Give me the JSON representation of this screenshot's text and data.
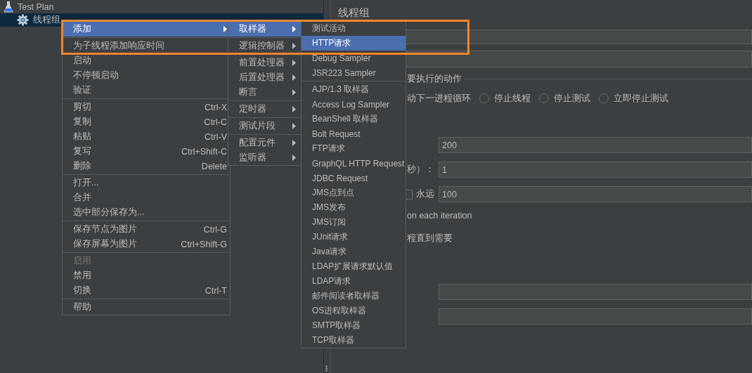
{
  "tree": [
    {
      "label": "Test Plan",
      "selected": false,
      "children": [
        {
          "label": "线程组",
          "selected": true
        }
      ]
    }
  ],
  "panel": {
    "title": "线程组",
    "group_label": "要执行的动作",
    "partial_label": "动下一进程循环",
    "radios": [
      {
        "label": "停止线程",
        "selected": false
      },
      {
        "label": "停止测试",
        "selected": false
      },
      {
        "label": "立即停止测试",
        "selected": false
      }
    ],
    "rows": [
      {
        "kind": "field",
        "value": "200"
      },
      {
        "kind": "field",
        "label": "秒）：",
        "value": "1"
      },
      {
        "kind": "checkbox-field",
        "label": "永远",
        "checked": false,
        "value": "100"
      },
      {
        "kind": "text",
        "label": "on each iteration"
      },
      {
        "kind": "text",
        "label": "程直到需要"
      },
      {
        "kind": "gap"
      },
      {
        "kind": "field"
      },
      {
        "kind": "field"
      }
    ]
  },
  "menus": [
    {
      "items": [
        {
          "kind": "item",
          "label": "添加",
          "submenu": true,
          "selected": true,
          "disabled": false
        },
        {
          "kind": "separator"
        },
        {
          "kind": "item",
          "label": "为子线程添加响应时间",
          "submenu": false,
          "selected": false,
          "disabled": false
        },
        {
          "kind": "item",
          "label": "启动",
          "submenu": false,
          "selected": false,
          "disabled": false
        },
        {
          "kind": "item",
          "label": "不停顿启动",
          "submenu": false,
          "selected": false,
          "disabled": false
        },
        {
          "kind": "item",
          "label": "验证",
          "submenu": false,
          "selected": false,
          "disabled": false
        },
        {
          "kind": "separator"
        },
        {
          "kind": "item",
          "label": "剪切",
          "shortcut": "Ctrl-X",
          "submenu": false,
          "selected": false,
          "disabled": false
        },
        {
          "kind": "item",
          "label": "复制",
          "shortcut": "Ctrl-C",
          "submenu": false,
          "selected": false,
          "disabled": false
        },
        {
          "kind": "item",
          "label": "粘贴",
          "shortcut": "Ctrl-V",
          "submenu": false,
          "selected": false,
          "disabled": false
        },
        {
          "kind": "item",
          "label": "复写",
          "shortcut": "Ctrl+Shift-C",
          "submenu": false,
          "selected": false,
          "disabled": false
        },
        {
          "kind": "item",
          "label": "删除",
          "shortcut": "Delete",
          "submenu": false,
          "selected": false,
          "disabled": false
        },
        {
          "kind": "separator"
        },
        {
          "kind": "item",
          "label": "打开...",
          "submenu": false,
          "selected": false,
          "disabled": false
        },
        {
          "kind": "item",
          "label": "合并",
          "submenu": false,
          "selected": false,
          "disabled": false
        },
        {
          "kind": "item",
          "label": "选中部分保存为...",
          "submenu": false,
          "selected": false,
          "disabled": false
        },
        {
          "kind": "separator"
        },
        {
          "kind": "item",
          "label": "保存节点为图片",
          "shortcut": "Ctrl-G",
          "submenu": false,
          "selected": false,
          "disabled": false
        },
        {
          "kind": "item",
          "label": "保存屏幕为图片",
          "shortcut": "Ctrl+Shift-G",
          "submenu": false,
          "selected": false,
          "disabled": false
        },
        {
          "kind": "separator"
        },
        {
          "kind": "item",
          "label": "启用",
          "submenu": false,
          "selected": false,
          "disabled": true
        },
        {
          "kind": "item",
          "label": "禁用",
          "submenu": false,
          "selected": false,
          "disabled": false
        },
        {
          "kind": "item",
          "label": "切换",
          "shortcut": "Ctrl-T",
          "submenu": false,
          "selected": false,
          "disabled": false
        },
        {
          "kind": "separator"
        },
        {
          "kind": "item",
          "label": "帮助",
          "submenu": false,
          "selected": false,
          "disabled": false
        }
      ]
    },
    {
      "items": [
        {
          "kind": "item",
          "label": "取样器",
          "submenu": true,
          "selected": true,
          "disabled": false
        },
        {
          "kind": "separator"
        },
        {
          "kind": "item",
          "label": "逻辑控制器",
          "submenu": true,
          "selected": false,
          "disabled": false
        },
        {
          "kind": "separator"
        },
        {
          "kind": "item",
          "label": "前置处理器",
          "submenu": true,
          "selected": false,
          "disabled": false
        },
        {
          "kind": "item",
          "label": "后置处理器",
          "submenu": true,
          "selected": false,
          "disabled": false
        },
        {
          "kind": "item",
          "label": "断言",
          "submenu": true,
          "selected": false,
          "disabled": false
        },
        {
          "kind": "separator"
        },
        {
          "kind": "item",
          "label": "定时器",
          "submenu": true,
          "selected": false,
          "disabled": false
        },
        {
          "kind": "separator"
        },
        {
          "kind": "item",
          "label": "测试片段",
          "submenu": true,
          "selected": false,
          "disabled": false
        },
        {
          "kind": "separator"
        },
        {
          "kind": "item",
          "label": "配置元件",
          "submenu": true,
          "selected": false,
          "disabled": false
        },
        {
          "kind": "item",
          "label": "监听器",
          "submenu": true,
          "selected": false,
          "disabled": false
        }
      ]
    },
    {
      "items": [
        {
          "kind": "item",
          "label": "测试活动",
          "selected": false,
          "disabled": false
        },
        {
          "kind": "item",
          "label": "HTTP请求",
          "selected": true,
          "disabled": false
        },
        {
          "kind": "item",
          "label": "Debug Sampler",
          "selected": false,
          "disabled": false
        },
        {
          "kind": "item",
          "label": "JSR223 Sampler",
          "selected": false,
          "disabled": false
        },
        {
          "kind": "separator"
        },
        {
          "kind": "item",
          "label": "AJP/1.3 取样器",
          "selected": false,
          "disabled": false
        },
        {
          "kind": "item",
          "label": "Access Log Sampler",
          "selected": false,
          "disabled": false
        },
        {
          "kind": "item",
          "label": "BeanShell 取样器",
          "selected": false,
          "disabled": false
        },
        {
          "kind": "item",
          "label": "Bolt Request",
          "selected": false,
          "disabled": false
        },
        {
          "kind": "item",
          "label": "FTP请求",
          "selected": false,
          "disabled": false
        },
        {
          "kind": "item",
          "label": "GraphQL HTTP Request",
          "selected": false,
          "disabled": false
        },
        {
          "kind": "item",
          "label": "JDBC Request",
          "selected": false,
          "disabled": false
        },
        {
          "kind": "item",
          "label": "JMS点到点",
          "selected": false,
          "disabled": false
        },
        {
          "kind": "item",
          "label": "JMS发布",
          "selected": false,
          "disabled": false
        },
        {
          "kind": "item",
          "label": "JMS订阅",
          "selected": false,
          "disabled": false
        },
        {
          "kind": "item",
          "label": "JUnit请求",
          "selected": false,
          "disabled": false
        },
        {
          "kind": "item",
          "label": "Java请求",
          "selected": false,
          "disabled": false
        },
        {
          "kind": "item",
          "label": "LDAP扩展请求默认值",
          "selected": false,
          "disabled": false
        },
        {
          "kind": "item",
          "label": "LDAP请求",
          "selected": false,
          "disabled": false
        },
        {
          "kind": "item",
          "label": "邮件阅读者取样器",
          "selected": false,
          "disabled": false
        },
        {
          "kind": "item",
          "label": "OS进程取样器",
          "selected": false,
          "disabled": false
        },
        {
          "kind": "item",
          "label": "SMTP取样器",
          "selected": false,
          "disabled": false
        },
        {
          "kind": "item",
          "label": "TCP取样器",
          "selected": false,
          "disabled": false
        }
      ]
    }
  ],
  "highlight_box": {
    "shown": true
  }
}
